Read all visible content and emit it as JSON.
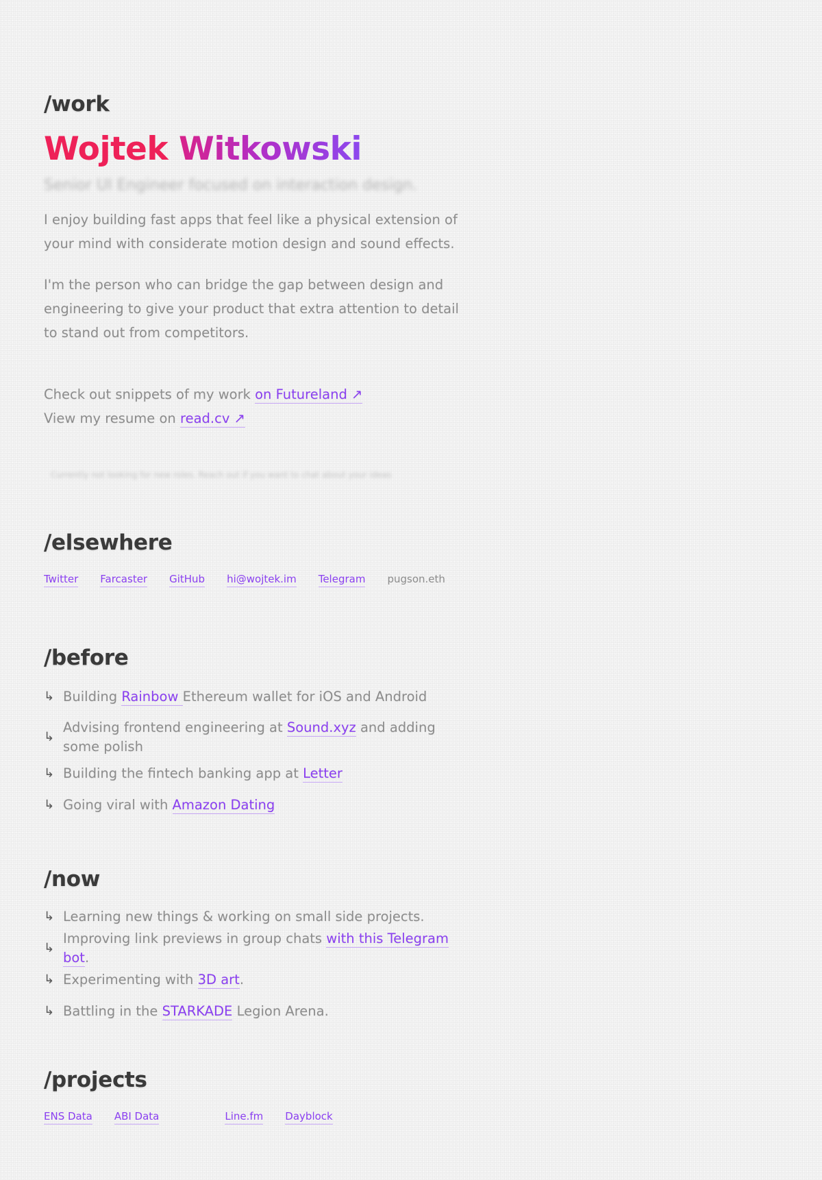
{
  "work": {
    "heading": "/work",
    "name_first": "Wojtek",
    "name_last": "Witkowski",
    "subtitle": "Senior UI Engineer focused on interaction design.",
    "para1": "I enjoy building fast apps that feel like a physical extension of your mind with considerate motion design and sound effects.",
    "para2": "I'm the person who can bridge the gap between design and engineering to give your product that extra attention to detail to stand out from competitors.",
    "snippets_prefix": "Check out snippets of my work ",
    "snippets_link": "on Futureland ↗",
    "resume_prefix": "View my resume on ",
    "resume_link": "read.cv ↗",
    "hidden_note": "Currently not looking for new roles. Reach out if you want to chat about your ideas"
  },
  "elsewhere": {
    "heading": "/elsewhere",
    "links": [
      "Twitter",
      "Farcaster",
      "GitHub",
      "hi@wojtek.im",
      "Telegram"
    ],
    "ens": "pugson.eth"
  },
  "before": {
    "heading": "/before",
    "items": [
      {
        "pre": "Building ",
        "link": "Rainbow ",
        "post": " Ethereum wallet for iOS and Android"
      },
      {
        "pre": "Advising frontend engineering at ",
        "link": "Sound.xyz",
        "post": " and adding some polish"
      },
      {
        "pre": "Building the fintech banking app at ",
        "link": "Letter",
        "post": ""
      },
      {
        "pre": "Going viral with ",
        "link": "Amazon Dating",
        "post": ""
      }
    ]
  },
  "now": {
    "heading": "/now",
    "items": [
      {
        "pre": "Learning new things & working on small side projects.",
        "link": "",
        "post": ""
      },
      {
        "pre": "Improving link previews in group chats ",
        "link": "with this Telegram bot",
        "post": "."
      },
      {
        "pre": "Experimenting with ",
        "link": "3D art",
        "post": "."
      },
      {
        "pre": "Battling in the ",
        "link": "STARKADE",
        "post": " Legion Arena."
      }
    ]
  },
  "projects": {
    "heading": "/projects",
    "links": [
      "ENS Data",
      "ABI Data",
      "Line.fm",
      "Dayblock"
    ]
  },
  "colors": {
    "accent": "#8a3ff0",
    "name_first": "#ee2158",
    "heading": "#3a3a3a",
    "body_text": "#8c8c8c",
    "background": "#f3f3f3"
  }
}
